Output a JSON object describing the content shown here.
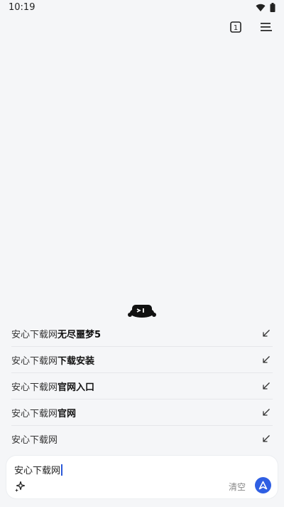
{
  "status_bar": {
    "time": "10:19"
  },
  "toolbar": {
    "tab_count": "1"
  },
  "suggestions": [
    {
      "match": "安心下载网",
      "rest": "无尽噩梦5"
    },
    {
      "match": "安心下载网",
      "rest": "下载安装"
    },
    {
      "match": "安心下载网",
      "rest": "官网入口"
    },
    {
      "match": "安心下载网",
      "rest": "官网"
    },
    {
      "match": "安心下载网",
      "rest": ""
    }
  ],
  "search": {
    "value": "安心下载网",
    "clear_label": "清空"
  },
  "colors": {
    "background": "#f5f6f8",
    "accent": "#2f5fe3",
    "caret": "#2b59d9"
  }
}
